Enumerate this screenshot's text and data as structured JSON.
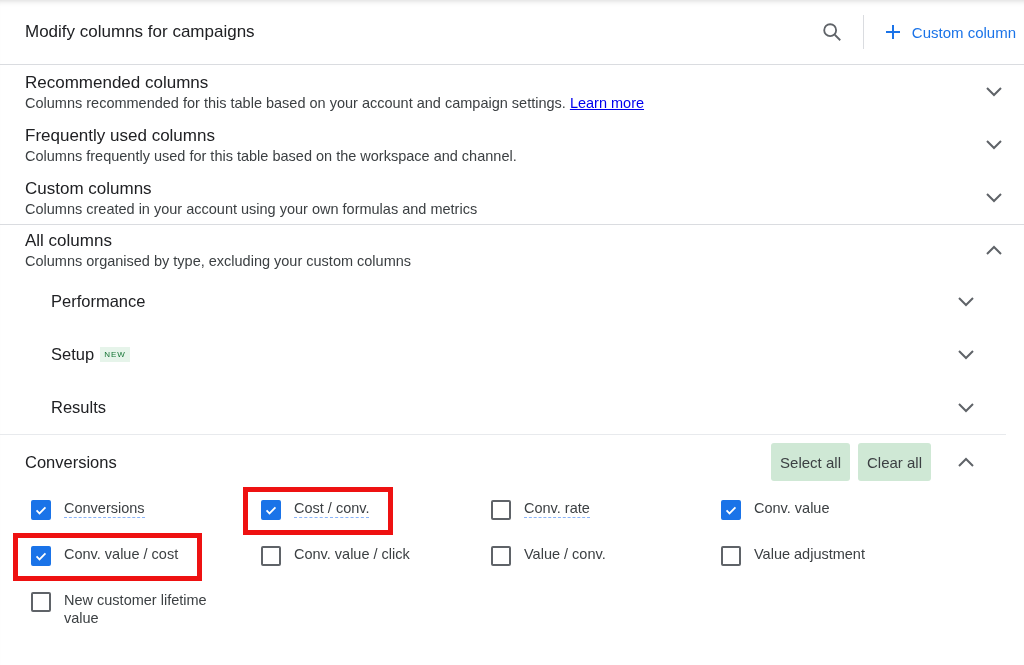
{
  "header": {
    "title": "Modify columns for campaigns",
    "action": "Custom column"
  },
  "sections": [
    {
      "title": "Recommended columns",
      "description": "Columns recommended for this table based on your account and campaign settings.",
      "link": "Learn more",
      "expanded": false
    },
    {
      "title": "Frequently used columns",
      "description": "Columns frequently used for this table based on the workspace and channel.",
      "expanded": false
    },
    {
      "title": "Custom columns",
      "description": "Columns created in your account using your own formulas and metrics",
      "expanded": false
    },
    {
      "title": "All columns",
      "description": "Columns organised by type, excluding your custom columns",
      "expanded": true
    }
  ],
  "categories": [
    {
      "title": "Performance",
      "expanded": false
    },
    {
      "title": "Setup",
      "badge": "NEW",
      "expanded": false
    },
    {
      "title": "Results",
      "expanded": false
    },
    {
      "title": "Conversions",
      "expanded": true,
      "buttons": [
        "Select all",
        "Clear all"
      ],
      "options": [
        {
          "label": "Conversions",
          "checked": true,
          "underlined": true,
          "highlighted": false
        },
        {
          "label": "Cost / conv.",
          "checked": true,
          "underlined": true,
          "highlighted": true
        },
        {
          "label": "Conv. rate",
          "checked": false,
          "underlined": true,
          "highlighted": false
        },
        {
          "label": "Conv. value",
          "checked": true,
          "underlined": false,
          "highlighted": false
        },
        {
          "label": "Conv. value / cost",
          "checked": true,
          "underlined": false,
          "highlighted": true
        },
        {
          "label": "Conv. value / click",
          "checked": false,
          "underlined": false,
          "highlighted": false
        },
        {
          "label": "Value / conv.",
          "checked": false,
          "underlined": false,
          "highlighted": false
        },
        {
          "label": "Value adjustment",
          "checked": false,
          "underlined": false,
          "highlighted": false
        },
        {
          "label": "New customer lifetime value",
          "checked": false,
          "underlined": false,
          "highlighted": false
        }
      ]
    }
  ]
}
